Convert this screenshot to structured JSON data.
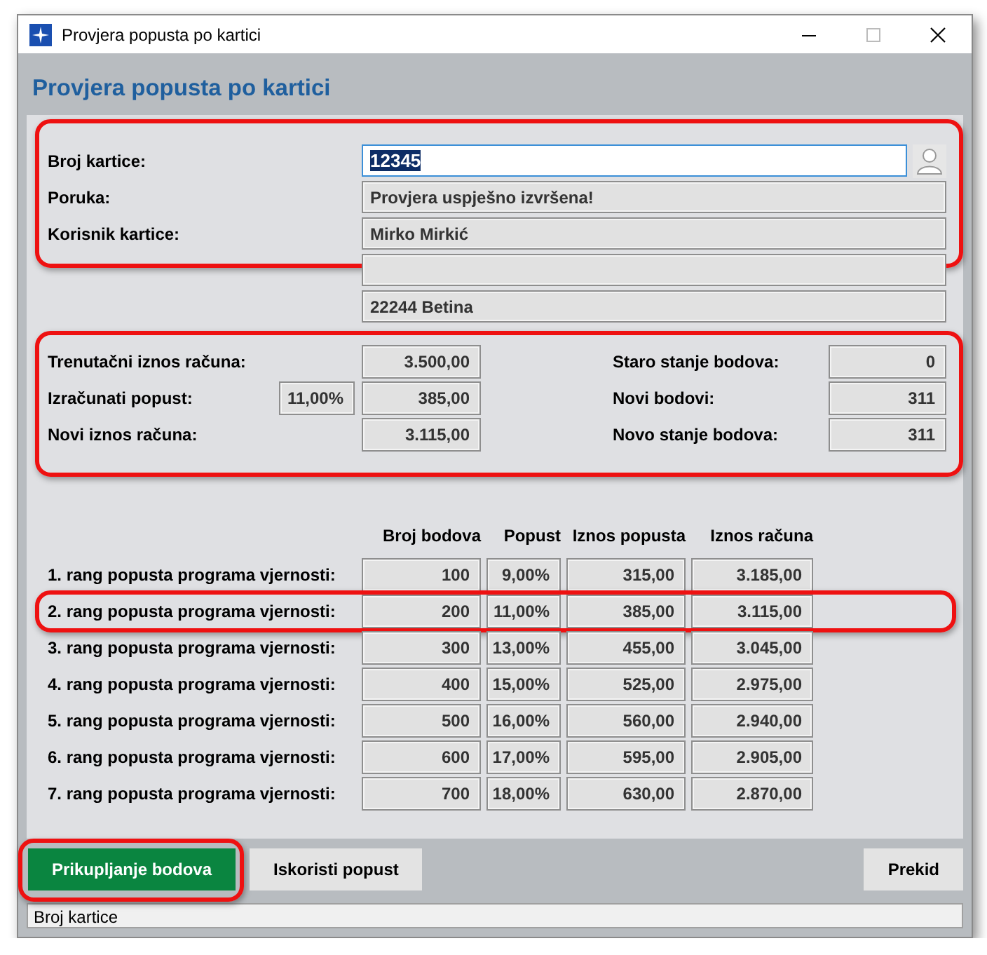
{
  "window": {
    "title": "Provjera popusta po kartici"
  },
  "header": "Provjera popusta po kartici",
  "card": {
    "highlighted": true,
    "fields": [
      {
        "kind": "input",
        "label": "Broj kartice:",
        "value": "12345",
        "text_selected": true
      },
      {
        "kind": "readonly",
        "label": "Poruka:",
        "value": "Provjera uspješno izvršena!"
      },
      {
        "kind": "readonly",
        "label": "Korisnik kartice:",
        "value": "Mirko Mirkić"
      }
    ]
  },
  "address": [
    {
      "kind": "blank"
    },
    {
      "kind": "text",
      "value": "22244 Betina"
    }
  ],
  "totals": {
    "highlighted": true,
    "rows": [
      {
        "label": "Trenutačni iznos računa:",
        "value": "3.500,00",
        "right_label": "Staro stanje bodova:",
        "right_value": "0"
      },
      {
        "label": "Izračunati popust:",
        "percent": "11,00%",
        "value": "385,00",
        "right_label": "Novi bodovi:",
        "right_value": "311"
      },
      {
        "label": "Novi iznos računa:",
        "value": "3.115,00",
        "right_label": "Novo stanje bodova:",
        "right_value": "311"
      }
    ]
  },
  "tiers": {
    "columns": [
      "Broj bodova",
      "Popust",
      "Iznos popusta",
      "Iznos računa"
    ],
    "rows": [
      {
        "label": "1. rang popusta programa vjernosti:",
        "cells": [
          "100",
          "9,00%",
          "315,00",
          "3.185,00"
        ],
        "highlighted": false
      },
      {
        "label": "2. rang popusta programa vjernosti:",
        "cells": [
          "200",
          "11,00%",
          "385,00",
          "3.115,00"
        ],
        "highlighted": true
      },
      {
        "label": "3. rang popusta programa vjernosti:",
        "cells": [
          "300",
          "13,00%",
          "455,00",
          "3.045,00"
        ],
        "highlighted": false
      },
      {
        "label": "4. rang popusta programa vjernosti:",
        "cells": [
          "400",
          "15,00%",
          "525,00",
          "2.975,00"
        ],
        "highlighted": false
      },
      {
        "label": "5. rang popusta programa vjernosti:",
        "cells": [
          "500",
          "16,00%",
          "560,00",
          "2.940,00"
        ],
        "highlighted": false
      },
      {
        "label": "6. rang popusta programa vjernosti:",
        "cells": [
          "600",
          "17,00%",
          "595,00",
          "2.905,00"
        ],
        "highlighted": false
      },
      {
        "label": "7. rang popusta programa vjernosti:",
        "cells": [
          "700",
          "18,00%",
          "630,00",
          "2.870,00"
        ],
        "highlighted": false
      }
    ]
  },
  "buttons": [
    {
      "label": "Prikupljanje bodova",
      "kind": "primary",
      "highlighted": true
    },
    {
      "label": "Iskoristi popust",
      "kind": "default",
      "highlighted": false
    },
    {
      "label": "Prekid",
      "kind": "cancel",
      "highlighted": false
    }
  ],
  "status_bar": "Broj kartice"
}
